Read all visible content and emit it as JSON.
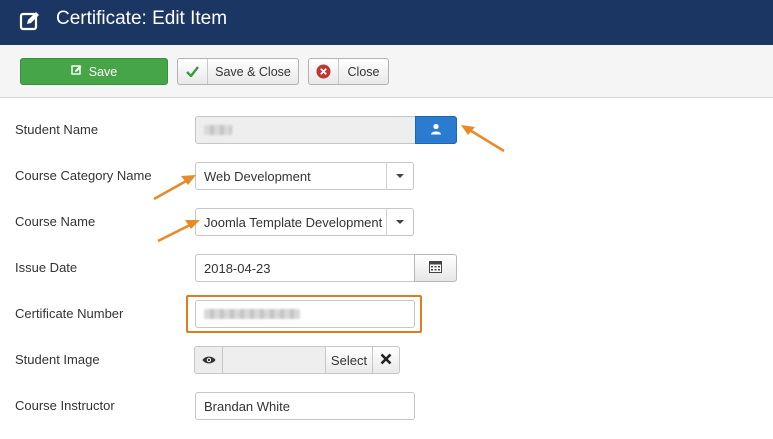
{
  "header": {
    "title": "Certificate: Edit Item",
    "icon": "edit-icon"
  },
  "toolbar": {
    "save_label": "Save",
    "save_close_label": "Save & Close",
    "close_label": "Close"
  },
  "form": {
    "student_name": {
      "label": "Student Name",
      "value": ""
    },
    "course_category": {
      "label": "Course Category Name",
      "value": "Web Development"
    },
    "course_name": {
      "label": "Course Name",
      "value": "Joomla Template Development"
    },
    "issue_date": {
      "label": "Issue Date",
      "value": "2018-04-23"
    },
    "certificate_number": {
      "label": "Certificate Number",
      "value": ""
    },
    "student_image": {
      "label": "Student Image",
      "select_label": "Select"
    },
    "course_instructor": {
      "label": "Course Instructor",
      "value": "Brandan White"
    }
  },
  "colors": {
    "header_bg": "#1c3664",
    "save_green": "#46a546",
    "user_btn_blue": "#2b7bd1",
    "annotation_orange": "#e07b1e"
  }
}
